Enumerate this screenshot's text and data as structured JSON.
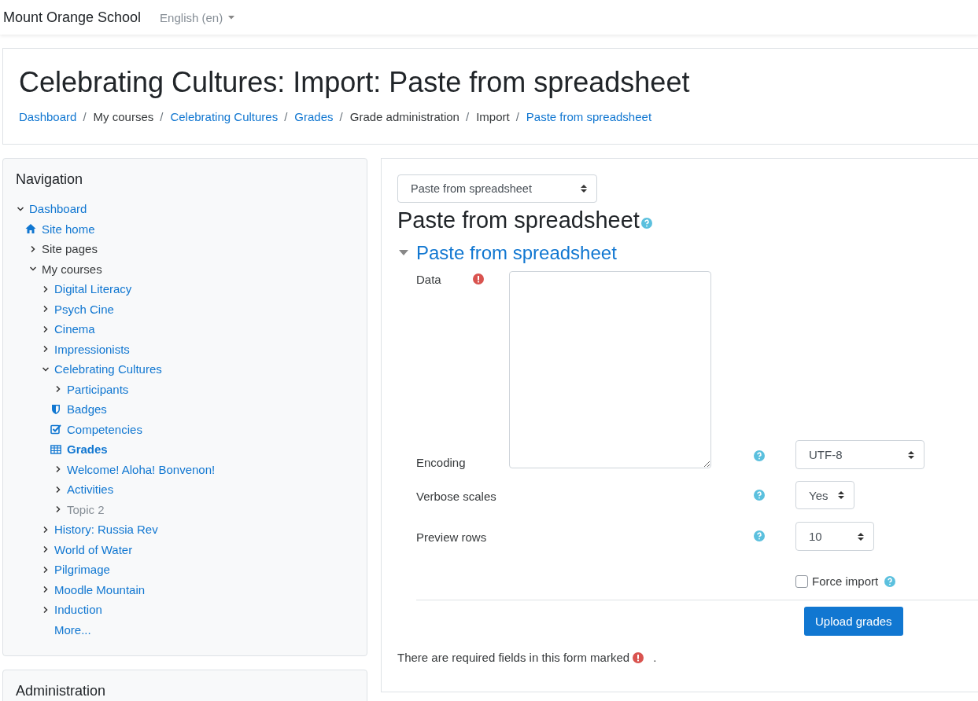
{
  "navbar": {
    "site_name": "Mount Orange School",
    "language": "English (en)"
  },
  "header": {
    "title": "Celebrating Cultures: Import: Paste from spreadsheet",
    "separator": "/",
    "breadcrumb": [
      {
        "label": "Dashboard",
        "link": true
      },
      {
        "label": "My courses",
        "link": false
      },
      {
        "label": "Celebrating Cultures",
        "link": true
      },
      {
        "label": "Grades",
        "link": true
      },
      {
        "label": "Grade administration",
        "link": false
      },
      {
        "label": "Import",
        "link": false
      },
      {
        "label": "Paste from spreadsheet",
        "link": true
      }
    ]
  },
  "navigation": {
    "title": "Navigation",
    "items": [
      {
        "label": "Dashboard",
        "kind": "branch",
        "expanded": true,
        "link": true,
        "dimmed": false,
        "selected": false,
        "children": [
          {
            "label": "Site home",
            "kind": "home",
            "link": true,
            "dimmed": false,
            "selected": false
          },
          {
            "label": "Site pages",
            "kind": "branch",
            "expanded": false,
            "link": false,
            "dimmed": false,
            "selected": false
          },
          {
            "label": "My courses",
            "kind": "branch",
            "expanded": true,
            "link": false,
            "dimmed": false,
            "selected": false,
            "children": [
              {
                "label": "Digital Literacy",
                "kind": "branch",
                "expanded": false,
                "link": true,
                "dimmed": false,
                "selected": false
              },
              {
                "label": "Psych Cine",
                "kind": "branch",
                "expanded": false,
                "link": true,
                "dimmed": false,
                "selected": false
              },
              {
                "label": "Cinema",
                "kind": "branch",
                "expanded": false,
                "link": true,
                "dimmed": false,
                "selected": false
              },
              {
                "label": "Impressionists",
                "kind": "branch",
                "expanded": false,
                "link": true,
                "dimmed": false,
                "selected": false
              },
              {
                "label": "Celebrating Cultures",
                "kind": "branch",
                "expanded": true,
                "link": true,
                "dimmed": false,
                "selected": false,
                "children": [
                  {
                    "label": "Participants",
                    "kind": "branch",
                    "expanded": false,
                    "link": true,
                    "dimmed": false,
                    "selected": false
                  },
                  {
                    "label": "Badges",
                    "kind": "badge",
                    "link": true,
                    "dimmed": false,
                    "selected": false
                  },
                  {
                    "label": "Competencies",
                    "kind": "competency",
                    "link": true,
                    "dimmed": false,
                    "selected": false
                  },
                  {
                    "label": "Grades",
                    "kind": "grades",
                    "link": true,
                    "dimmed": false,
                    "selected": true
                  },
                  {
                    "label": "Welcome! Aloha! Bonvenon!",
                    "kind": "branch",
                    "expanded": false,
                    "link": true,
                    "dimmed": false,
                    "selected": false
                  },
                  {
                    "label": "Activities",
                    "kind": "branch",
                    "expanded": false,
                    "link": true,
                    "dimmed": false,
                    "selected": false
                  },
                  {
                    "label": "Topic 2",
                    "kind": "branch",
                    "expanded": false,
                    "link": true,
                    "dimmed": true,
                    "selected": false
                  }
                ]
              },
              {
                "label": "History: Russia Rev",
                "kind": "branch",
                "expanded": false,
                "link": true,
                "dimmed": false,
                "selected": false
              },
              {
                "label": "World of Water",
                "kind": "branch",
                "expanded": false,
                "link": true,
                "dimmed": false,
                "selected": false
              },
              {
                "label": "Pilgrimage",
                "kind": "branch",
                "expanded": false,
                "link": true,
                "dimmed": false,
                "selected": false
              },
              {
                "label": "Moodle Mountain",
                "kind": "branch",
                "expanded": false,
                "link": true,
                "dimmed": false,
                "selected": false
              },
              {
                "label": "Induction",
                "kind": "branch",
                "expanded": false,
                "link": true,
                "dimmed": false,
                "selected": false
              },
              {
                "label": "More...",
                "kind": "plain",
                "link": true,
                "dimmed": false,
                "selected": false
              }
            ]
          }
        ]
      }
    ]
  },
  "administration": {
    "title": "Administration"
  },
  "main": {
    "import_select": "Paste from spreadsheet",
    "heading": "Paste from spreadsheet",
    "section": {
      "title": "Paste from spreadsheet",
      "expanded": true
    },
    "data_label": "Data",
    "encoding": {
      "label": "Encoding",
      "value": "UTF-8"
    },
    "verbose_scales": {
      "label": "Verbose scales",
      "value": "Yes"
    },
    "preview_rows": {
      "label": "Preview rows",
      "value": "10"
    },
    "force_import": {
      "label": "Force import",
      "checked": false
    },
    "submit": "Upload grades",
    "required_note": "There are required fields in this form marked",
    "required_note_end": "."
  }
}
